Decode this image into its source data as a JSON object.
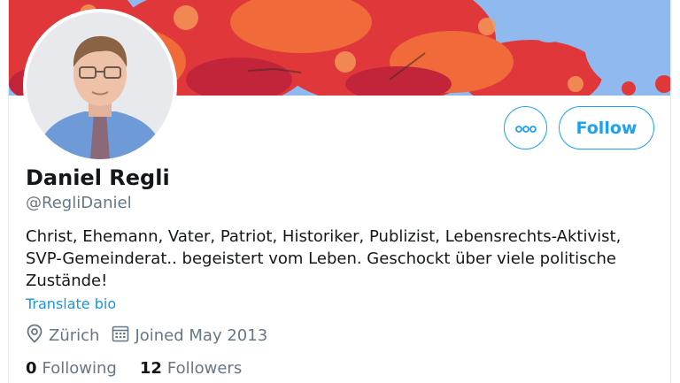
{
  "profile": {
    "name": "Daniel Regli",
    "handle": "@RegliDaniel",
    "bio": "Christ, Ehemann, Vater, Patriot, Historiker, Publizist, Lebensrechts-Aktivist, SVP-Gemeinderat.. begeistert vom Leben. Geschockt über viele politische Zustände!",
    "translate_label": "Translate bio",
    "location": "Zürich",
    "joined": "Joined May 2013",
    "following_count": "0",
    "following_label": "Following",
    "followers_count": "12",
    "followers_label": "Followers"
  },
  "actions": {
    "follow_label": "Follow",
    "more_icon": "more-options-icon"
  },
  "icons": {
    "location": "location-pin-icon",
    "calendar": "calendar-icon"
  },
  "colors": {
    "accent": "#1da1f2",
    "text_primary": "#14171a",
    "text_secondary": "#657786",
    "link": "#1b95e0"
  }
}
